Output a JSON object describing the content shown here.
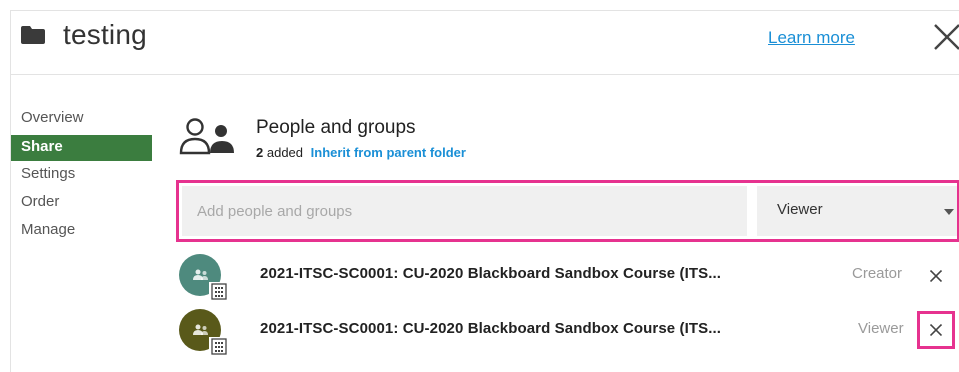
{
  "header": {
    "title": "testing",
    "learn_more": "Learn more",
    "folder_icon": "folder-icon",
    "close_icon": "close-icon"
  },
  "sidebar": {
    "items": [
      {
        "label": "Overview",
        "active": false
      },
      {
        "label": "Share",
        "active": true
      },
      {
        "label": "Settings",
        "active": false
      },
      {
        "label": "Order",
        "active": false
      },
      {
        "label": "Manage",
        "active": false
      }
    ]
  },
  "share": {
    "icon": "people-groups-icon",
    "title": "People and groups",
    "added_count": "2",
    "added_text": "added",
    "inherit_link": "Inherit from parent folder",
    "add_placeholder": "Add people and groups",
    "role_selected": "Viewer"
  },
  "members": [
    {
      "name": "2021-ITSC-SC0001: CU-2020 Blackboard Sandbox Course (ITS...",
      "role": "Creator",
      "avatar_color": "#4e8a7e",
      "icon": "group-avatar-icon"
    },
    {
      "name": "2021-ITSC-SC0001: CU-2020 Blackboard Sandbox Course (ITS...",
      "role": "Viewer",
      "avatar_color": "#59591a",
      "icon": "group-avatar-icon"
    }
  ],
  "colors": {
    "accent_green": "#3b7d3f",
    "link_blue": "#1a8fd6",
    "highlight_pink": "#e6328f"
  }
}
